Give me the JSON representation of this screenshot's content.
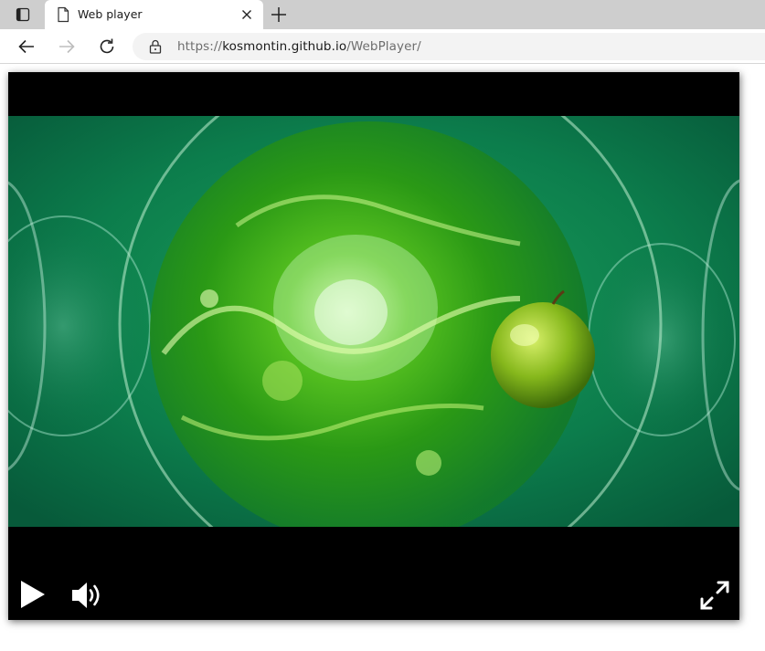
{
  "browser": {
    "tab": {
      "title": "Web player"
    },
    "address": {
      "scheme": "https://",
      "host": "kosmontin.github.io",
      "path": "/WebPlayer/"
    }
  },
  "player": {
    "state": "paused",
    "video_description": "green liquid splashing in a glass with a green apple",
    "controls": {
      "play_icon": "play-icon",
      "volume_icon": "speaker-icon",
      "fullscreen_icon": "expand-icon"
    },
    "colors": {
      "background": "#000000",
      "controls": "#ffffff",
      "video_tone": "#0c7a48"
    }
  }
}
